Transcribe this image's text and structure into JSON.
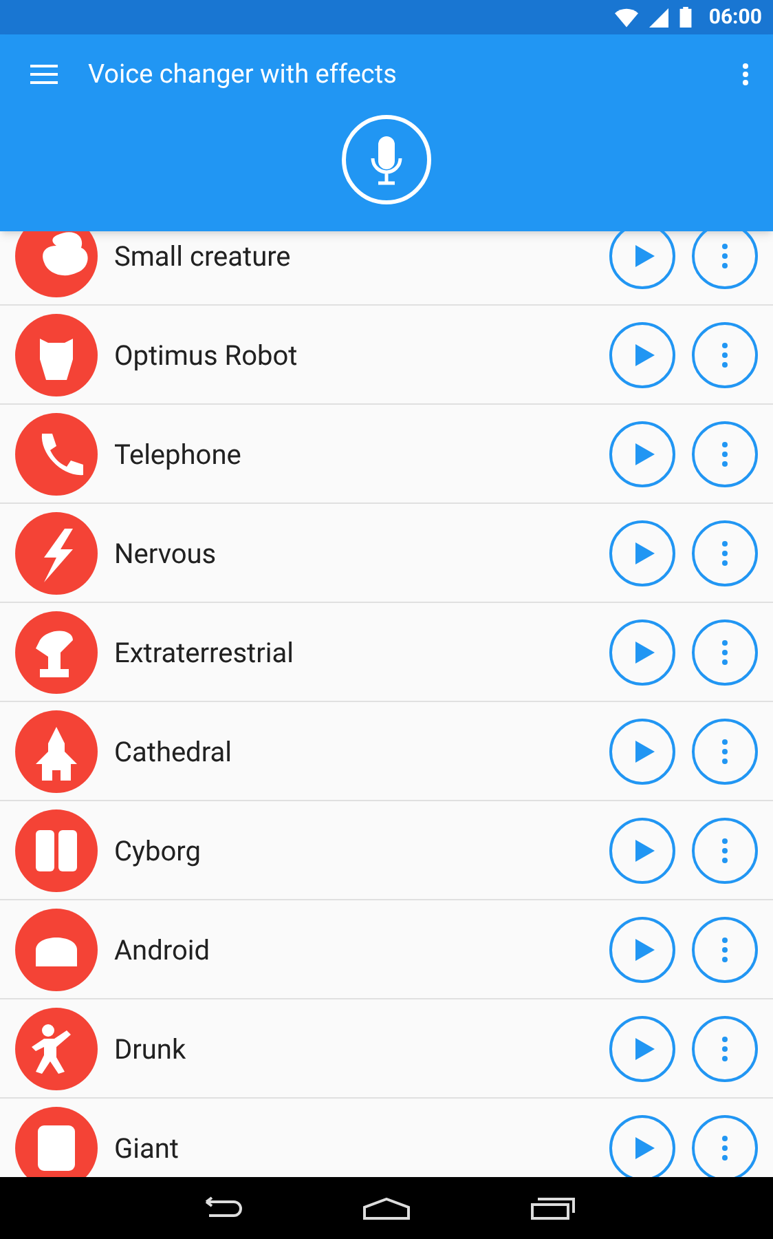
{
  "status_bar": {
    "time": "06:00"
  },
  "app_bar": {
    "title": "Voice changer with effects"
  },
  "effects": [
    {
      "name": "Small creature"
    },
    {
      "name": "Optimus Robot"
    },
    {
      "name": "Telephone"
    },
    {
      "name": "Nervous"
    },
    {
      "name": "Extraterrestrial"
    },
    {
      "name": "Cathedral"
    },
    {
      "name": "Cyborg"
    },
    {
      "name": "Android"
    },
    {
      "name": "Drunk"
    },
    {
      "name": "Giant"
    }
  ]
}
